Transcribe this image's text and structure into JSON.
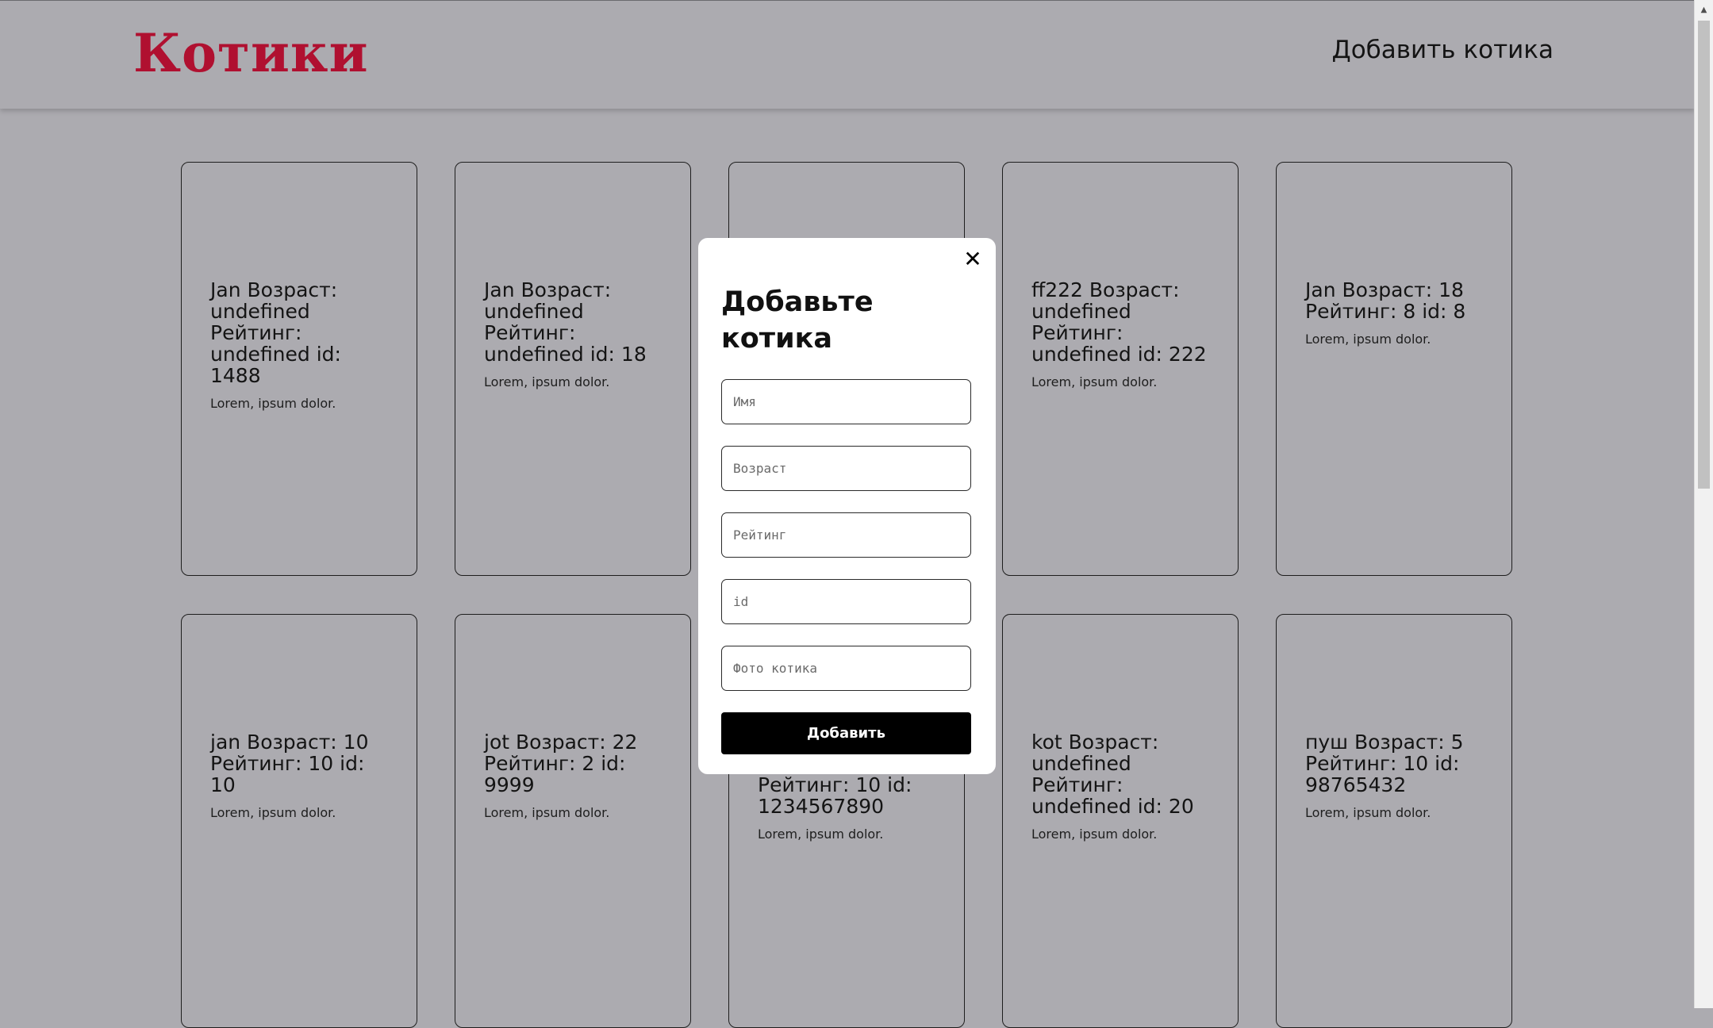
{
  "header": {
    "logo": "Котики",
    "add_link": "Добавить котика"
  },
  "cards": [
    {
      "title": "Jan Возраст: undefined Рейтинг: undefined id: 1488",
      "desc": "Lorem, ipsum dolor."
    },
    {
      "title": "Jan Возраст: undefined Рейтинг: undefined id: 18",
      "desc": "Lorem, ipsum dolor."
    },
    {
      "title": "",
      "desc": ""
    },
    {
      "title": "ff222 Возраст: undefined Рейтинг: undefined id: 222",
      "desc": "Lorem, ipsum dolor."
    },
    {
      "title": "Jan Возраст: 18 Рейтинг: 8 id: 8",
      "desc": "Lorem, ipsum dolor."
    },
    {
      "title": "jan Возраст: 10 Рейтинг: 10 id: 10",
      "desc": "Lorem, ipsum dolor."
    },
    {
      "title": "jot Возраст: 22 Рейтинг: 2 id: 9999",
      "desc": "Lorem, ipsum dolor."
    },
    {
      "title": "Рейтинг: 10 id: 1234567890",
      "desc": "Lorem, ipsum dolor."
    },
    {
      "title": "kot Возраст: undefined Рейтинг: undefined id: 20",
      "desc": "Lorem, ipsum dolor."
    },
    {
      "title": "пуш Возраст: 5 Рейтинг: 10 id: 98765432",
      "desc": "Lorem, ipsum dolor."
    }
  ],
  "modal": {
    "close_glyph": "✕",
    "title": "Добавьте котика",
    "fields": {
      "name": "Имя",
      "age": "Возраст",
      "rating": "Рейтинг",
      "id": "id",
      "photo": "Фото котика"
    },
    "submit": "Добавить"
  },
  "colors": {
    "page_bg": "#acabb0",
    "logo": "#b01030",
    "modal_bg": "#ffffff",
    "button_bg": "#000000"
  }
}
